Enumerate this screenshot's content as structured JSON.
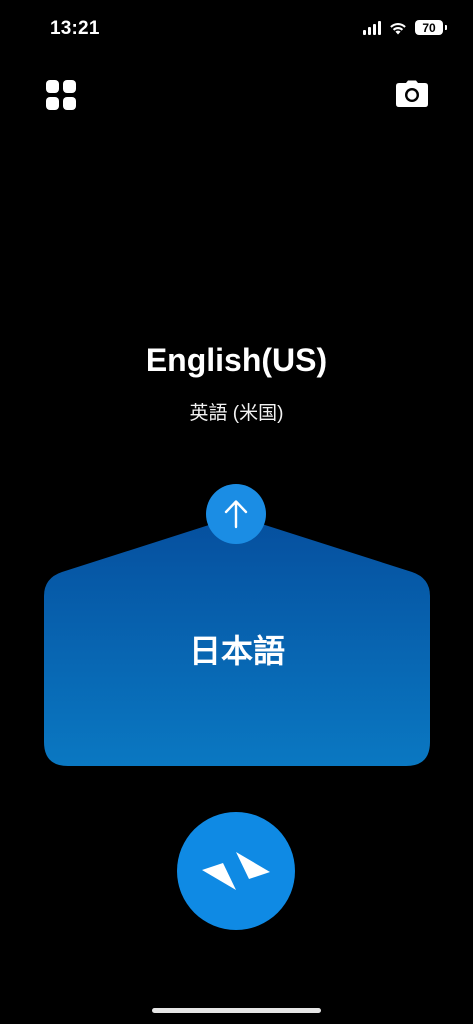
{
  "status_bar": {
    "time": "13:21",
    "battery": "70"
  },
  "toolbar": {
    "left_icon": "grid-icon",
    "right_icon": "camera-icon"
  },
  "target_language": {
    "name": "English(US)",
    "native_name": "英語 (米国)"
  },
  "source_language": {
    "name": "日本語"
  },
  "controls": {
    "swap_icon": "arrow-up-icon",
    "mic_icon": "conversation-icon"
  },
  "colors": {
    "background": "#000000",
    "panel_top": "#054f9e",
    "panel_bottom": "#0a78c2",
    "accent": "#0f8ae4"
  }
}
